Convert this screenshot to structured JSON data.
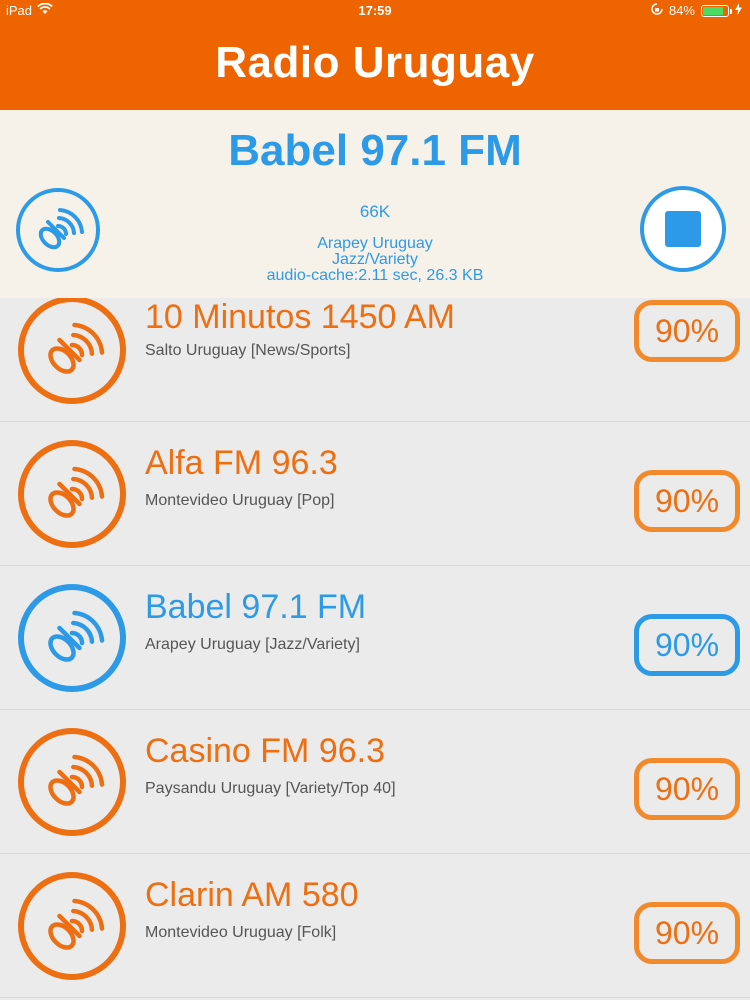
{
  "status_bar": {
    "device": "iPad",
    "time": "17:59",
    "battery": "84%",
    "battery_level": 0.84
  },
  "nav": {
    "title": "Radio Uruguay"
  },
  "now_playing": {
    "title": "Babel 97.1 FM",
    "bitrate": "66K",
    "location": "Arapey Uruguay",
    "genre": "Jazz/Variety",
    "cache": "audio-cache:2.11 sec, 26.3 KB",
    "station_icon": "radio-broadcast-icon",
    "stop_icon": "stop-icon"
  },
  "colors": {
    "orange": "#ee6400",
    "blue": "#2d9ae8",
    "panel": "#f6f2e9",
    "list_bg": "#ebebeb"
  },
  "stations": [
    {
      "name": "10 Minutos 1450 AM",
      "subtitle": "Salto Uruguay [News/Sports]",
      "quality": "90%",
      "active": false
    },
    {
      "name": "Alfa FM 96.3",
      "subtitle": "Montevideo Uruguay [Pop]",
      "quality": "90%",
      "active": false
    },
    {
      "name": "Babel 97.1 FM",
      "subtitle": "Arapey Uruguay [Jazz/Variety]",
      "quality": "90%",
      "active": true
    },
    {
      "name": "Casino FM 96.3",
      "subtitle": "Paysandu Uruguay [Variety/Top 40]",
      "quality": "90%",
      "active": false
    },
    {
      "name": "Clarin AM 580",
      "subtitle": "Montevideo Uruguay [Folk]",
      "quality": "90%",
      "active": false
    }
  ]
}
